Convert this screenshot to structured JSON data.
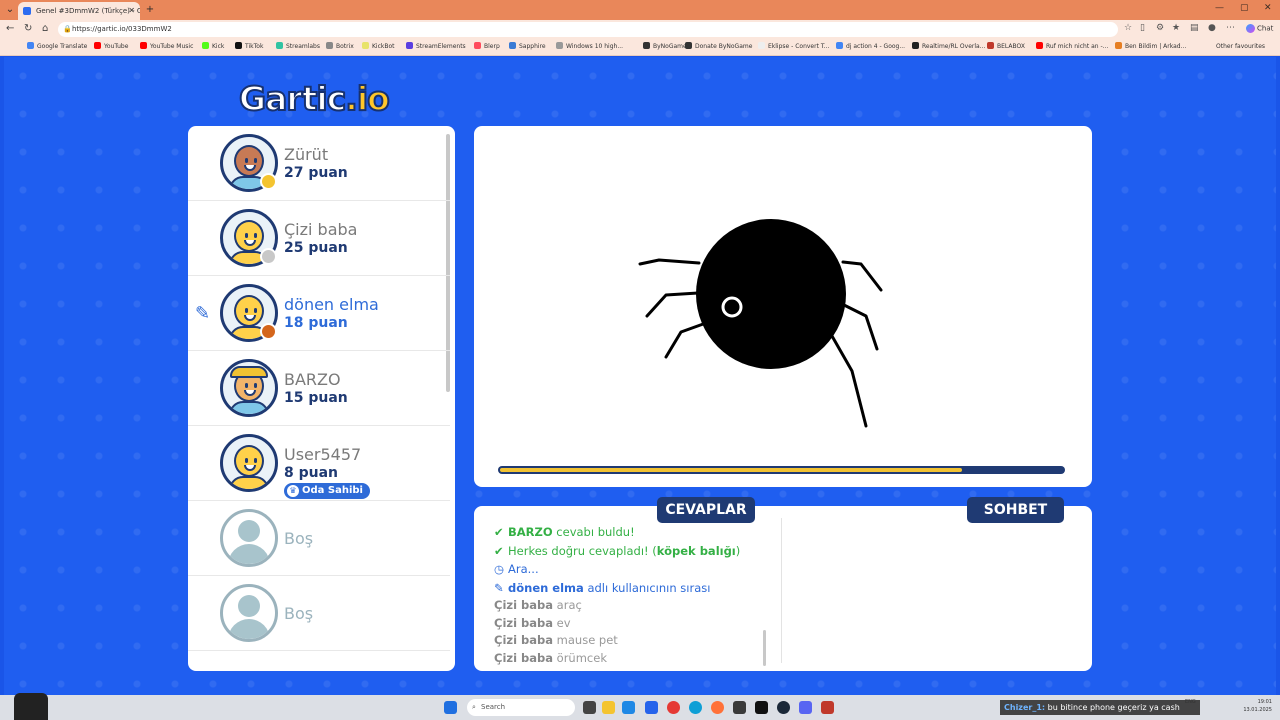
{
  "browser": {
    "tab_title": "Genel #3DmmW2 (Türkçe) - Gartic...",
    "url": "https://gartic.io/033DmmW2",
    "copilot_label": "Chat",
    "bookmarks": [
      {
        "label": "Google Translate",
        "color": "#4285f4"
      },
      {
        "label": "YouTube",
        "color": "#ff0000"
      },
      {
        "label": "YouTube Music",
        "color": "#ff0000"
      },
      {
        "label": "Kick",
        "color": "#53fc18"
      },
      {
        "label": "TikTok",
        "color": "#111111"
      },
      {
        "label": "Streamlabs",
        "color": "#31c3a2"
      },
      {
        "label": "Botrix",
        "color": "#888888"
      },
      {
        "label": "KickBot",
        "color": "#e8e36a"
      },
      {
        "label": "StreamElements",
        "color": "#5a3ee0"
      },
      {
        "label": "Blerp",
        "color": "#ff4b5c"
      },
      {
        "label": "Sapphire",
        "color": "#3a7bd5"
      },
      {
        "label": "Windows 10 high...",
        "color": "#999999"
      },
      {
        "label": "ByNoGame",
        "color": "#333333"
      },
      {
        "label": "Donate ByNoGame",
        "color": "#333333"
      },
      {
        "label": "Eklipse - Convert T...",
        "color": "#eeeeee"
      },
      {
        "label": "dj action 4 - Goog...",
        "color": "#4285f4"
      },
      {
        "label": "Realtime/RL Overla...",
        "color": "#222222"
      },
      {
        "label": "BELABOX",
        "color": "#c0392b"
      },
      {
        "label": "Ruf mich nicht an -...",
        "color": "#ff0000"
      },
      {
        "label": "Ben Bildim | Arkad...",
        "color": "#e67e22"
      }
    ],
    "other_favourites": "Other favourites"
  },
  "game": {
    "logo_main": "Gartic",
    "logo_suffix": ".io",
    "players": [
      {
        "name": "Zürüt",
        "score": "27 puan",
        "avatar": "dark",
        "status_color": "#f4c430"
      },
      {
        "name": "Çizi baba",
        "score": "25 puan",
        "avatar": "yellow",
        "status_color": "#c8c8c8"
      },
      {
        "name": "dönen elma",
        "score": "18 puan",
        "avatar": "yellow",
        "status_color": "#d4661c",
        "drawing": true
      },
      {
        "name": "BARZO",
        "score": "15 puan",
        "avatar": "cap"
      },
      {
        "name": "User5457",
        "score": "8 puan",
        "avatar": "yellow",
        "badge": "Oda Sahibi"
      },
      {
        "name": "Boş",
        "empty": true
      },
      {
        "name": "Boş",
        "empty": true
      }
    ],
    "timer_progress": 0.82,
    "tabs": {
      "answers": "CEVAPLAR",
      "chat": "SOHBET"
    },
    "answers": [
      {
        "type": "green",
        "icon": "✔",
        "bold": "BARZO",
        "text": " cevabı buldu!"
      },
      {
        "type": "green",
        "icon": "✔",
        "text_pre": "Herkes doğru cevapladı! (",
        "bold": "köpek balığı",
        "text": ")"
      },
      {
        "type": "blue",
        "icon": "◷",
        "text": "Ara..."
      },
      {
        "type": "blue",
        "icon": "✎",
        "bold": "dönen elma",
        "text": " adlı kullanıcının sırası"
      },
      {
        "type": "gray",
        "bold": "Çizi baba",
        "text": " araç"
      },
      {
        "type": "gray",
        "bold": "Çizi baba",
        "text": " ev"
      },
      {
        "type": "gray",
        "bold": "Çizi baba",
        "text": " mause pet"
      },
      {
        "type": "gray",
        "bold": "Çizi baba",
        "text": " örümcek"
      }
    ]
  },
  "taskbar": {
    "search_placeholder": "Search",
    "chat_user": "Chizer_1:",
    "chat_message": " bu bitince phone geçeriz ya cash",
    "lang": "ENG",
    "time": "19:01",
    "date": "13.01.2025"
  }
}
